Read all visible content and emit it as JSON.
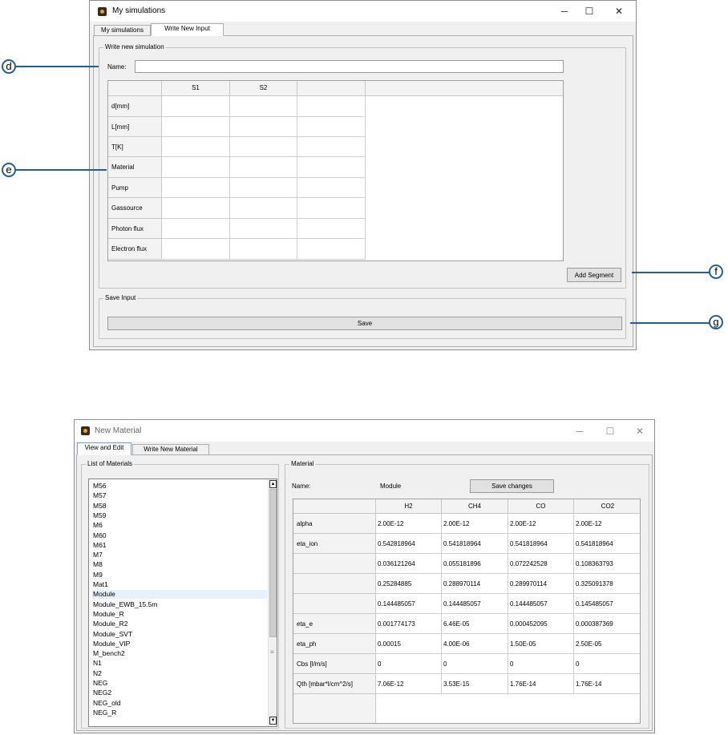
{
  "window1": {
    "title": "My simulations",
    "tabs": [
      {
        "label": "My simulations"
      },
      {
        "label": "Write New Input",
        "active": true
      }
    ],
    "group_write": {
      "title": "Write new simulation",
      "name_label": "Name:",
      "name_value": "",
      "columns": [
        "S1",
        "S2",
        ""
      ],
      "rows": [
        "d[mm]",
        "L[mm]",
        "T[K]",
        "Material",
        "Pump",
        "Gassource",
        "Photon flux",
        "Electron flux"
      ],
      "add_segment_label": "Add Segment"
    },
    "group_save": {
      "title": "Save Input",
      "save_label": "Save"
    }
  },
  "callouts": {
    "d": "d",
    "e": "e",
    "f": "f",
    "g": "g"
  },
  "window2": {
    "title": "New Material",
    "tabs": [
      {
        "label": "View and Edit",
        "active": true
      },
      {
        "label": "Write New Material"
      }
    ],
    "list_group": {
      "title": "List of Materials",
      "items": [
        "M56",
        "M57",
        "M58",
        "M59",
        "M6",
        "M60",
        "M61",
        "M7",
        "M8",
        "M9",
        "Mat1",
        "Module",
        "Module_EWB_15.5m",
        "Module_R",
        "Module_R2",
        "Module_SVT",
        "Module_VIP",
        "M_bench2",
        "N1",
        "N2",
        "NEG",
        "NEG2",
        "NEG_old",
        "NEG_R"
      ],
      "selected": "Module"
    },
    "material_group": {
      "title": "Material",
      "name_label": "Name:",
      "name_value": "Module",
      "save_changes_label": "Save changes",
      "table": {
        "columns": [
          "H2",
          "CH4",
          "CO",
          "CO2"
        ],
        "rows": [
          {
            "label": "alpha",
            "values": [
              "2.00E-12",
              "2.00E-12",
              "2.00E-12",
              "2.00E-12"
            ]
          },
          {
            "label": "eta_ion",
            "values": [
              "0.542818964",
              "0.541818964",
              "0.541818964",
              "0.541818964"
            ]
          },
          {
            "label": "",
            "values": [
              "0.036121264",
              "0.055181896",
              "0.072242528",
              "0.108363793"
            ]
          },
          {
            "label": "",
            "values": [
              "0.25284885",
              "0.288970114",
              "0.289970114",
              "0.325091378"
            ]
          },
          {
            "label": "",
            "values": [
              "0.144485057",
              "0.144485057",
              "0.144485057",
              "0.145485057"
            ]
          },
          {
            "label": "eta_e",
            "values": [
              "0.001774173",
              "6.46E-05",
              "0.000452095",
              "0.000387369"
            ]
          },
          {
            "label": "eta_ph",
            "values": [
              "0.00015",
              "4.00E-06",
              "1.50E-05",
              "2.50E-05"
            ]
          },
          {
            "label": "Cbs [l/m/s]",
            "values": [
              "0",
              "0",
              "0",
              "0"
            ]
          },
          {
            "label": "Qth [mbar*l/cm^2/s]",
            "values": [
              "7.06E-12",
              "3.53E-15",
              "1.76E-14",
              "1.76E-14"
            ]
          }
        ]
      }
    }
  },
  "icons": {
    "minimize": "─",
    "maximize": "☐",
    "close": "✕",
    "scroll_up": "▲",
    "scroll_down": "▼",
    "grip": "≡"
  }
}
